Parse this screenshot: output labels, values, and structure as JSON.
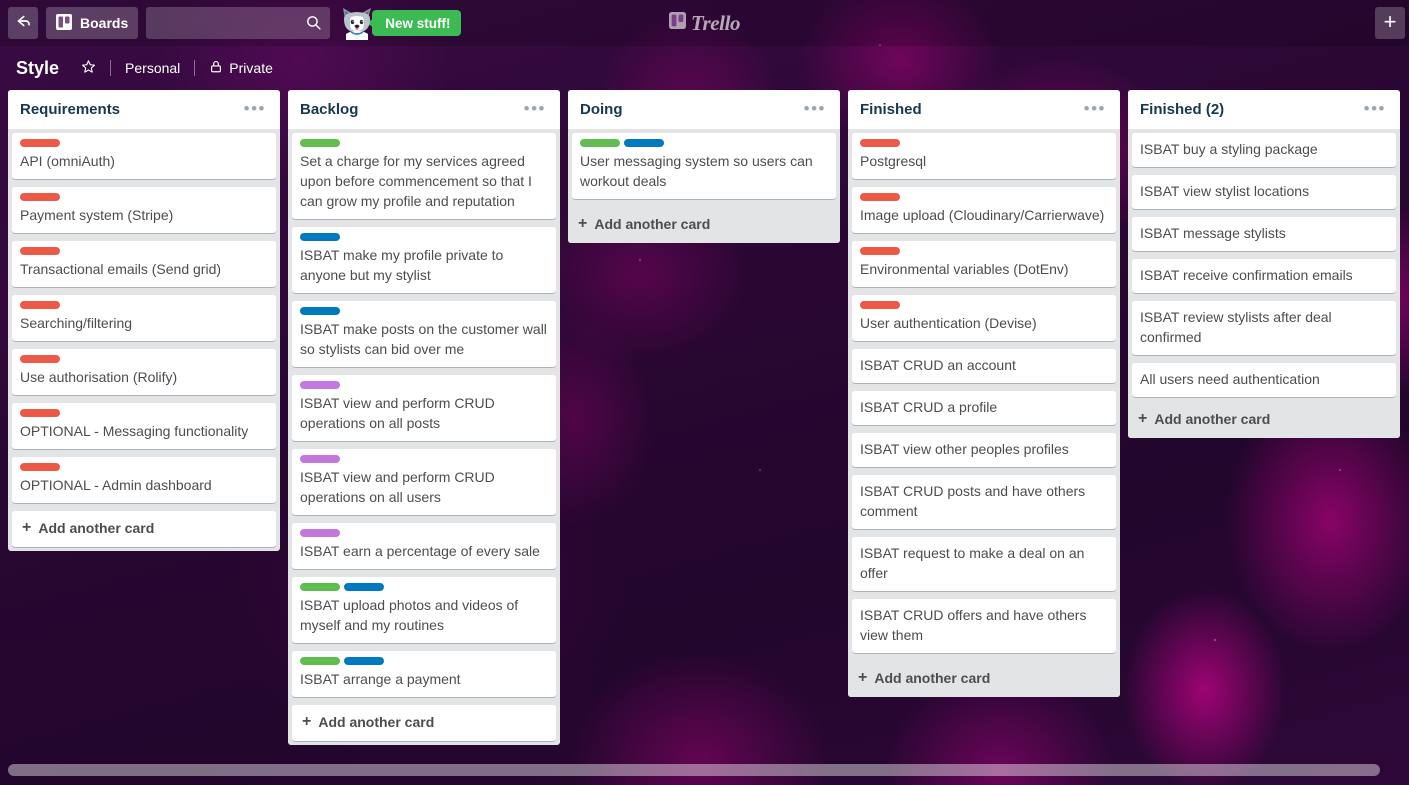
{
  "header": {
    "back_icon": "back-arrow-icon",
    "boards_label": "Boards",
    "boards_icon": "board-grid-icon",
    "search_placeholder": "",
    "search_value": "",
    "search_icon": "search-icon",
    "mascot_icon": "husky-mascot-icon",
    "new_stuff_label": "New stuff!",
    "logo_text": "Trello",
    "logo_icon": "trello-logo-icon",
    "add_label": "+"
  },
  "board_header": {
    "title": "Style",
    "star_icon": "star-icon",
    "team_label": "Personal",
    "visibility_label": "Private",
    "lock_icon": "lock-icon"
  },
  "colors": {
    "label_red": "#eb5a46",
    "label_green": "#61bd4f",
    "label_blue": "#0079bf",
    "label_purple": "#c377e0",
    "badge_green": "#3cba54",
    "list_bg": "#e2e4e6",
    "card_bg": "#ffffff",
    "card_text": "#4d4d4d",
    "list_title": "#17394d"
  },
  "add_card_label": "Add another card",
  "list_menu_icon": "ellipsis-icon",
  "lists": [
    {
      "title": "Requirements",
      "scroll": false,
      "add_card_floating": true,
      "cards": [
        {
          "labels": [
            "#eb5a46"
          ],
          "title": "API (omniAuth)"
        },
        {
          "labels": [
            "#eb5a46"
          ],
          "title": "Payment system (Stripe)"
        },
        {
          "labels": [
            "#eb5a46"
          ],
          "title": "Transactional emails (Send grid)"
        },
        {
          "labels": [
            "#eb5a46"
          ],
          "title": "Searching/filtering"
        },
        {
          "labels": [
            "#eb5a46"
          ],
          "title": "Use authorisation (Rolify)"
        },
        {
          "labels": [
            "#eb5a46"
          ],
          "title": "OPTIONAL - Messaging functionality"
        },
        {
          "labels": [
            "#eb5a46"
          ],
          "title": "OPTIONAL - Admin dashboard"
        }
      ]
    },
    {
      "title": "Backlog",
      "scroll": true,
      "add_card_floating": true,
      "cards": [
        {
          "labels": [
            "#61bd4f"
          ],
          "title": "Set a charge for my services agreed upon before commencement so that I can grow my profile and reputation"
        },
        {
          "labels": [
            "#0079bf"
          ],
          "title": "ISBAT make my profile private to anyone but my stylist"
        },
        {
          "labels": [
            "#0079bf"
          ],
          "title": "ISBAT make posts on the customer wall so stylists can bid over me"
        },
        {
          "labels": [
            "#c377e0"
          ],
          "title": "ISBAT view and perform CRUD operations on all posts"
        },
        {
          "labels": [
            "#c377e0"
          ],
          "title": "ISBAT view and perform CRUD operations on all users"
        },
        {
          "labels": [
            "#c377e0"
          ],
          "title": "ISBAT earn a percentage of every sale"
        },
        {
          "labels": [
            "#61bd4f",
            "#0079bf"
          ],
          "title": "ISBAT upload photos and videos of myself and my routines"
        },
        {
          "labels": [
            "#61bd4f",
            "#0079bf"
          ],
          "title": "ISBAT arrange a payment"
        }
      ]
    },
    {
      "title": "Doing",
      "scroll": false,
      "add_card_floating": false,
      "cards": [
        {
          "labels": [
            "#61bd4f",
            "#0079bf"
          ],
          "title": "User messaging system so users can workout deals"
        }
      ]
    },
    {
      "title": "Finished",
      "scroll": false,
      "add_card_floating": false,
      "cards": [
        {
          "labels": [
            "#eb5a46"
          ],
          "title": "Postgresql"
        },
        {
          "labels": [
            "#eb5a46"
          ],
          "title": "Image upload (Cloudinary/Carrierwave)"
        },
        {
          "labels": [
            "#eb5a46"
          ],
          "title": "Environmental variables (DotEnv)"
        },
        {
          "labels": [
            "#eb5a46"
          ],
          "title": "User authentication (Devise)"
        },
        {
          "labels": [],
          "title": "ISBAT CRUD an account"
        },
        {
          "labels": [],
          "title": "ISBAT CRUD a profile"
        },
        {
          "labels": [],
          "title": "ISBAT view other peoples profiles"
        },
        {
          "labels": [],
          "title": "ISBAT CRUD posts and have others comment"
        },
        {
          "labels": [],
          "title": "ISBAT request to make a deal on an offer"
        },
        {
          "labels": [],
          "title": "ISBAT CRUD offers and have others view them"
        }
      ]
    },
    {
      "title": "Finished (2)",
      "scroll": false,
      "add_card_floating": false,
      "cards": [
        {
          "labels": [],
          "title": "ISBAT buy a styling package"
        },
        {
          "labels": [],
          "title": "ISBAT view stylist locations"
        },
        {
          "labels": [],
          "title": "ISBAT message stylists"
        },
        {
          "labels": [],
          "title": "ISBAT receive confirmation emails"
        },
        {
          "labels": [],
          "title": "ISBAT review stylists after deal confirmed"
        },
        {
          "labels": [],
          "title": "All users need authentication"
        }
      ]
    }
  ]
}
